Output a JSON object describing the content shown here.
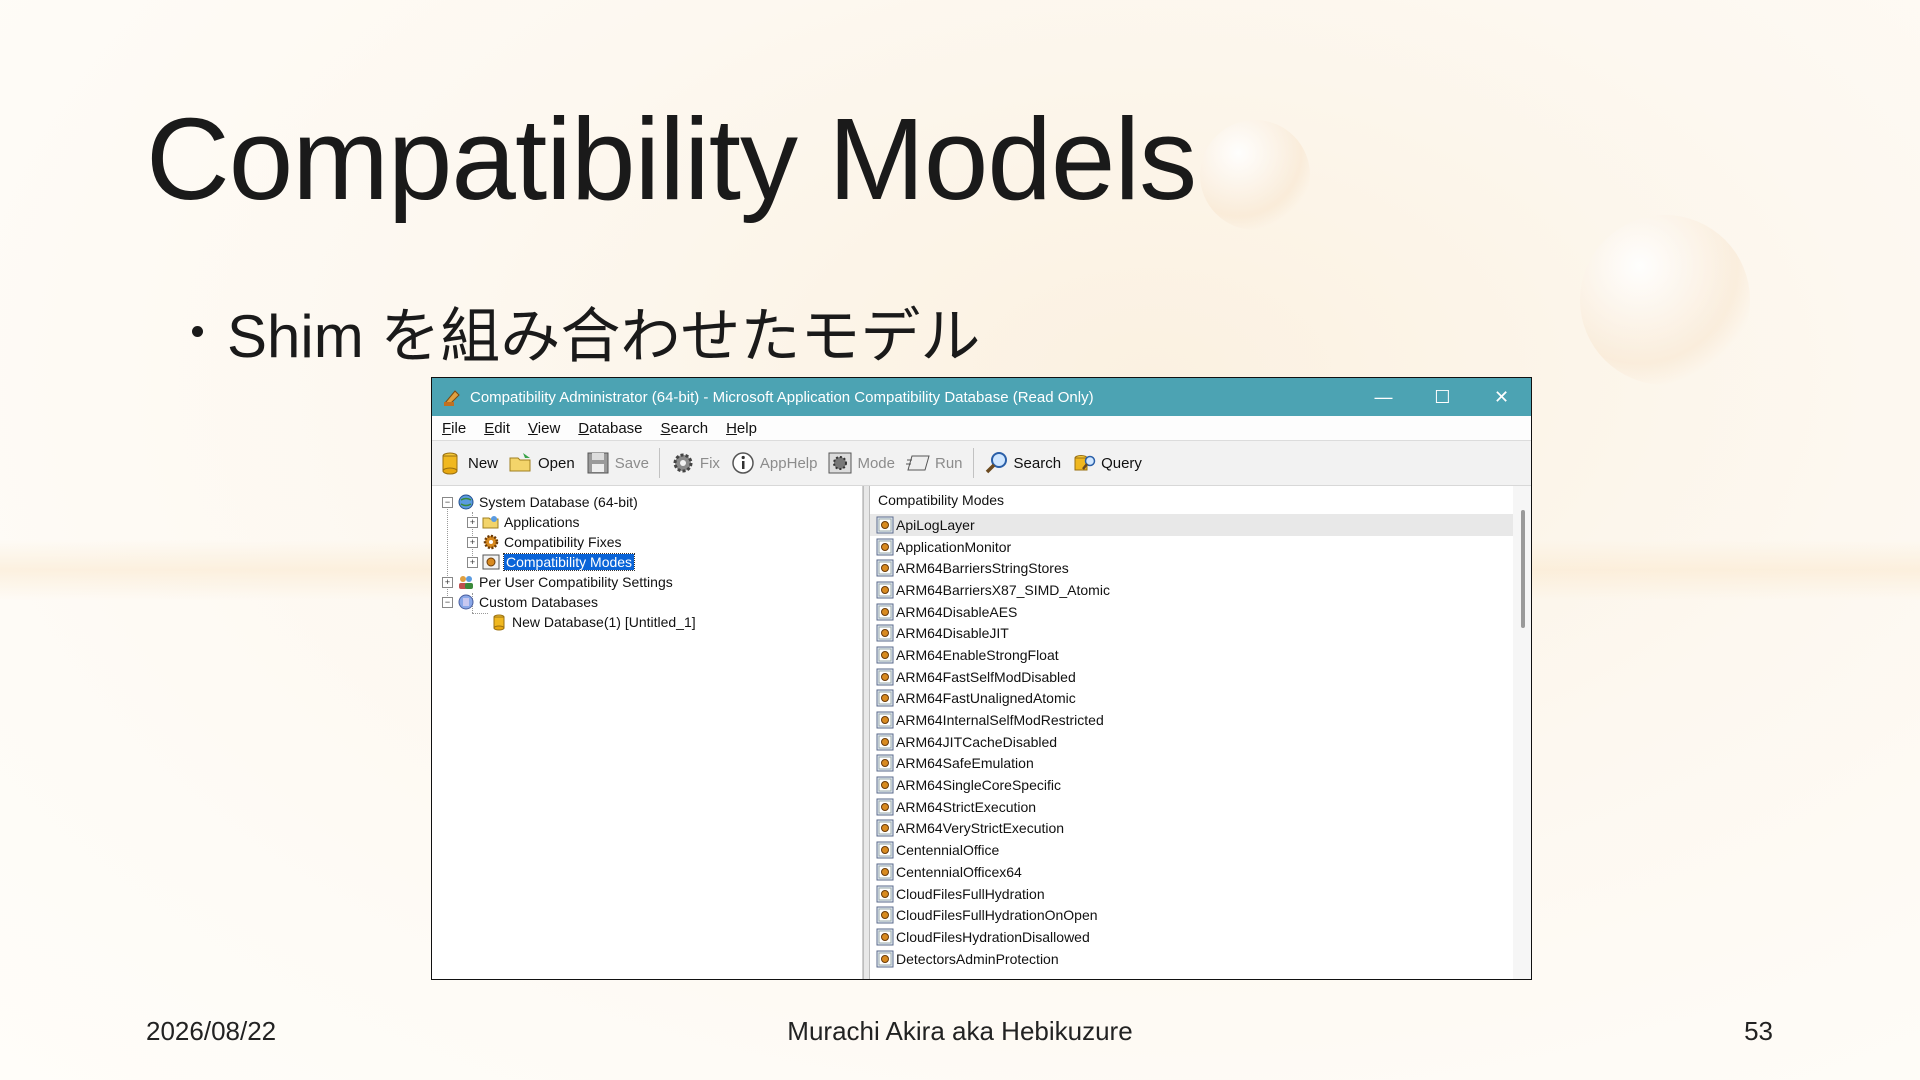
{
  "slide": {
    "title": "Compatibility Models",
    "bullet": "Shim を組み合わせたモデル",
    "footer": {
      "date": "2026/08/22",
      "author": "Murachi Akira aka Hebikuzure",
      "page": "53"
    }
  },
  "window": {
    "title": "Compatibility Administrator (64-bit) - Microsoft Application Compatibility Database (Read Only)",
    "controls": {
      "minimize": "—",
      "maximize": "☐",
      "close": "✕"
    },
    "menu": [
      {
        "underline": "F",
        "rest": "ile"
      },
      {
        "underline": "E",
        "rest": "dit"
      },
      {
        "underline": "V",
        "rest": "iew"
      },
      {
        "underline": "D",
        "rest": "atabase"
      },
      {
        "underline": "S",
        "rest": "earch"
      },
      {
        "underline": "H",
        "rest": "elp"
      }
    ],
    "toolbar": {
      "new": "New",
      "open": "Open",
      "save": "Save",
      "fix": "Fix",
      "apphelp": "AppHelp",
      "mode": "Mode",
      "run": "Run",
      "search": "Search",
      "query": "Query"
    },
    "tree": {
      "system_db": "System Database (64-bit)",
      "applications": "Applications",
      "compat_fixes": "Compatibility Fixes",
      "compat_modes": "Compatibility Modes",
      "per_user": "Per User Compatibility Settings",
      "custom_dbs": "Custom Databases",
      "new_db": "New Database(1) [Untitled_1]"
    },
    "list": {
      "header": "Compatibility Modes",
      "items": [
        "ApiLogLayer",
        "ApplicationMonitor",
        "ARM64BarriersStringStores",
        "ARM64BarriersX87_SIMD_Atomic",
        "ARM64DisableAES",
        "ARM64DisableJIT",
        "ARM64EnableStrongFloat",
        "ARM64FastSelfModDisabled",
        "ARM64FastUnalignedAtomic",
        "ARM64InternalSelfModRestricted",
        "ARM64JITCacheDisabled",
        "ARM64SafeEmulation",
        "ARM64SingleCoreSpecific",
        "ARM64StrictExecution",
        "ARM64VeryStrictExecution",
        "CentennialOffice",
        "CentennialOfficex64",
        "CloudFilesFullHydration",
        "CloudFilesFullHydrationOnOpen",
        "CloudFilesHydrationDisallowed",
        "DetectorsAdminProtection"
      ]
    }
  }
}
